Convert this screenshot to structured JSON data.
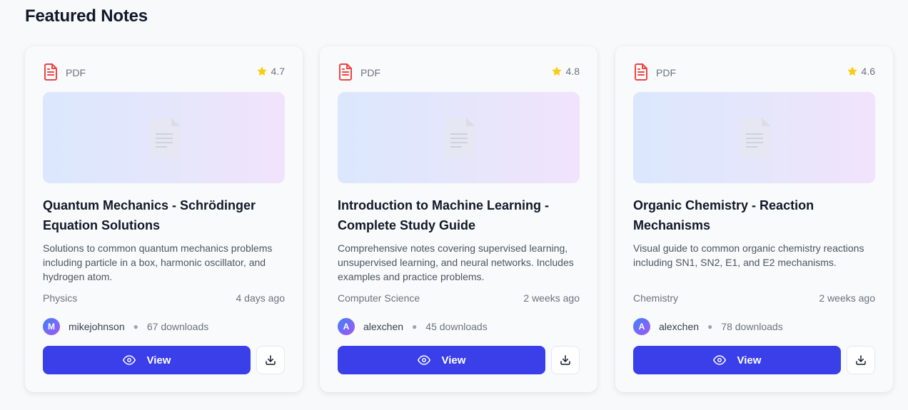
{
  "section": {
    "title": "Featured Notes"
  },
  "notes": [
    {
      "file_type": "PDF",
      "rating": "4.7",
      "title": "Quantum Mechanics - Schrödinger Equation Solutions",
      "description": "Solutions to common quantum mechanics problems including particle in a box, harmonic oscillator, and hydrogen atom.",
      "subject": "Physics",
      "date": "4 days ago",
      "avatar_initial": "M",
      "author": "mikejohnson",
      "downloads": "67 downloads",
      "view_label": "View"
    },
    {
      "file_type": "PDF",
      "rating": "4.8",
      "title": "Introduction to Machine Learning - Complete Study Guide",
      "description": "Comprehensive notes covering supervised learning, unsupervised learning, and neural networks. Includes examples and practice problems.",
      "subject": "Computer Science",
      "date": "2 weeks ago",
      "avatar_initial": "A",
      "author": "alexchen",
      "downloads": "45 downloads",
      "view_label": "View"
    },
    {
      "file_type": "PDF",
      "rating": "4.6",
      "title": "Organic Chemistry - Reaction Mechanisms",
      "description": "Visual guide to common organic chemistry reactions including SN1, SN2, E1, and E2 mechanisms.",
      "subject": "Chemistry",
      "date": "2 weeks ago",
      "avatar_initial": "A",
      "author": "alexchen",
      "downloads": "78 downloads",
      "view_label": "View"
    }
  ],
  "icons": {
    "file": "file-text-icon",
    "star": "star-icon",
    "document_placeholder": "document-placeholder-icon",
    "view": "eye-icon",
    "download": "download-icon"
  },
  "colors": {
    "primary_button": "#3a3fea",
    "pdf_icon": "#ef4444",
    "star": "#facc15",
    "avatar_gradient_start": "#3b82f6",
    "avatar_gradient_end": "#a855f7"
  }
}
